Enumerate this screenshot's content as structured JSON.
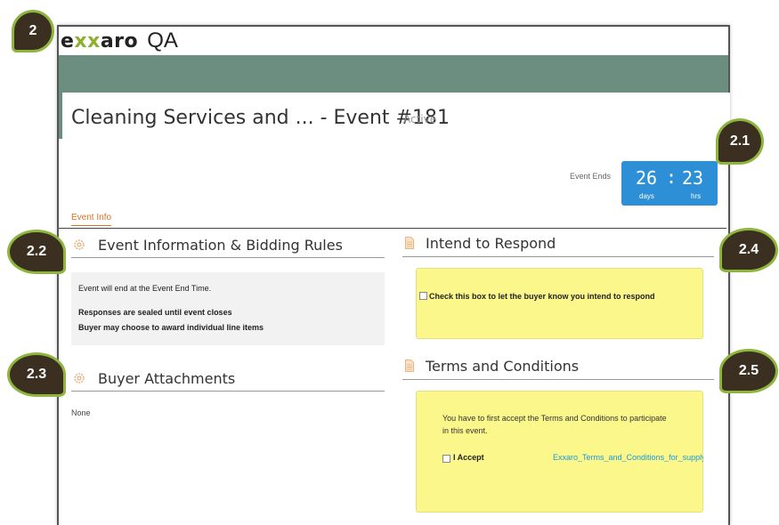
{
  "brand": {
    "logo_pre": "e",
    "logo_x": "xx",
    "logo_post": "aro",
    "app": "QA"
  },
  "event": {
    "title": "Cleaning Services and ... - Event #181",
    "status": "Active"
  },
  "countdown": {
    "label": "Event Ends",
    "days": "26",
    "sep": ":",
    "hours": "23",
    "days_label": "days",
    "hours_label": "hrs"
  },
  "tabs": {
    "event_info": "Event Info"
  },
  "event_info": {
    "heading": "Event Information & Bidding Rules",
    "line1": "Event will end at the Event End Time.",
    "line2": "Responses are sealed until event closes",
    "line3": "Buyer may choose to award individual line items"
  },
  "attachments": {
    "heading": "Buyer Attachments",
    "value": "None"
  },
  "intend": {
    "heading": "Intend to Respond",
    "checkbox_label": "Check this box to let the buyer know you intend to respond"
  },
  "terms": {
    "heading": "Terms and Conditions",
    "message": "You have to first accept the Terms and Conditions to participate in this event.",
    "accept_label": "I Accept",
    "link": "Exxaro_Terms_and_Conditions_for_supply"
  },
  "badges": {
    "b2": "2",
    "b21": "2.1",
    "b22": "2.2",
    "b23": "2.3",
    "b24": "2.4",
    "b25": "2.5"
  },
  "colors": {
    "header_bar": "#6b8e80",
    "countdown": "#2d8fd6",
    "accent": "#e07020",
    "highlight": "#fbf78b",
    "badge_fill": "#3b2f22",
    "badge_ring": "#8fb63c"
  }
}
